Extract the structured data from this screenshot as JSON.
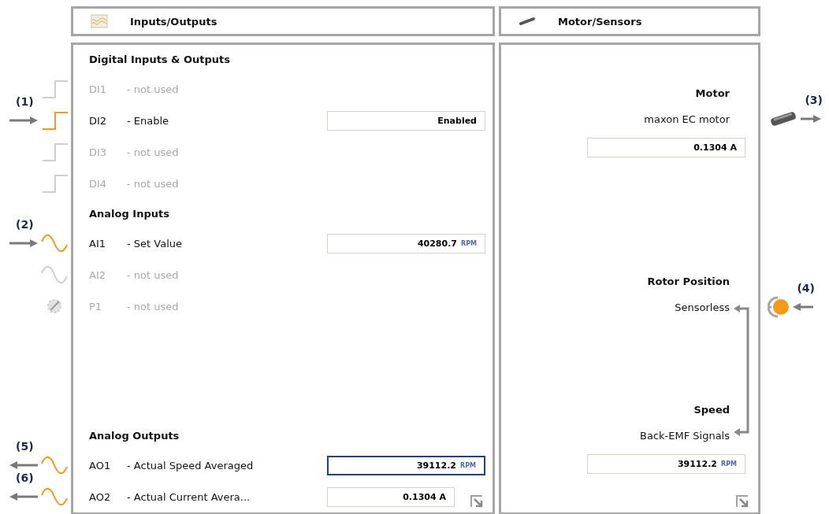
{
  "io_panel": {
    "title": "Inputs/Outputs",
    "sections": [
      {
        "heading": "Digital Inputs & Outputs",
        "items": [
          {
            "id": "DI1",
            "label": "- not used",
            "used": false,
            "kind": "digital"
          },
          {
            "id": "DI2",
            "label": "- Enable",
            "used": true,
            "kind": "digital",
            "field": {
              "value": "Enabled",
              "selected": false
            },
            "callout": {
              "label": "(1)",
              "outgoing": false
            }
          },
          {
            "id": "DI3",
            "label": "- not used",
            "used": false,
            "kind": "digital"
          },
          {
            "id": "DI4",
            "label": "- not used",
            "used": false,
            "kind": "digital"
          }
        ]
      },
      {
        "heading": "Analog Inputs",
        "items": [
          {
            "id": "AI1",
            "label": "- Set Value",
            "used": true,
            "kind": "analog",
            "field": {
              "value": "40280.7",
              "unit": "RPM",
              "selected": false
            },
            "callout": {
              "label": "(2)",
              "outgoing": false
            }
          },
          {
            "id": "AI2",
            "label": "- not used",
            "used": false,
            "kind": "analog"
          },
          {
            "id": "P1",
            "label": "- not used",
            "used": false,
            "kind": "potentiometer"
          }
        ]
      },
      {
        "heading": "Analog Outputs",
        "items": [
          {
            "id": "AO1",
            "label": "- Actual Speed Averaged",
            "used": true,
            "kind": "analog",
            "field": {
              "value": "39112.2",
              "unit": "RPM",
              "selected": true
            },
            "callout": {
              "label": "(5)",
              "outgoing": true
            }
          },
          {
            "id": "AO2",
            "label": "- Actual Current Avera...",
            "used": true,
            "kind": "analog",
            "field": {
              "value": "0.1304 A",
              "selected": false
            },
            "callout": {
              "label": "(6)",
              "outgoing": true
            }
          }
        ]
      }
    ]
  },
  "motor_panel": {
    "title": "Motor/Sensors",
    "groups": [
      {
        "heading": "Motor",
        "text": "maxon EC motor",
        "field": {
          "value": "0.1304 A"
        },
        "callout": {
          "label": "(3)",
          "outgoing": true,
          "kind": "motor"
        }
      },
      {
        "heading": "Rotor Position",
        "text": "Sensorless",
        "callout": {
          "label": "(4)",
          "outgoing": false,
          "kind": "sensor"
        }
      },
      {
        "heading": "Speed",
        "text": "Back-EMF Signals",
        "field": {
          "value": "39112.2",
          "unit": "RPM"
        }
      }
    ]
  }
}
